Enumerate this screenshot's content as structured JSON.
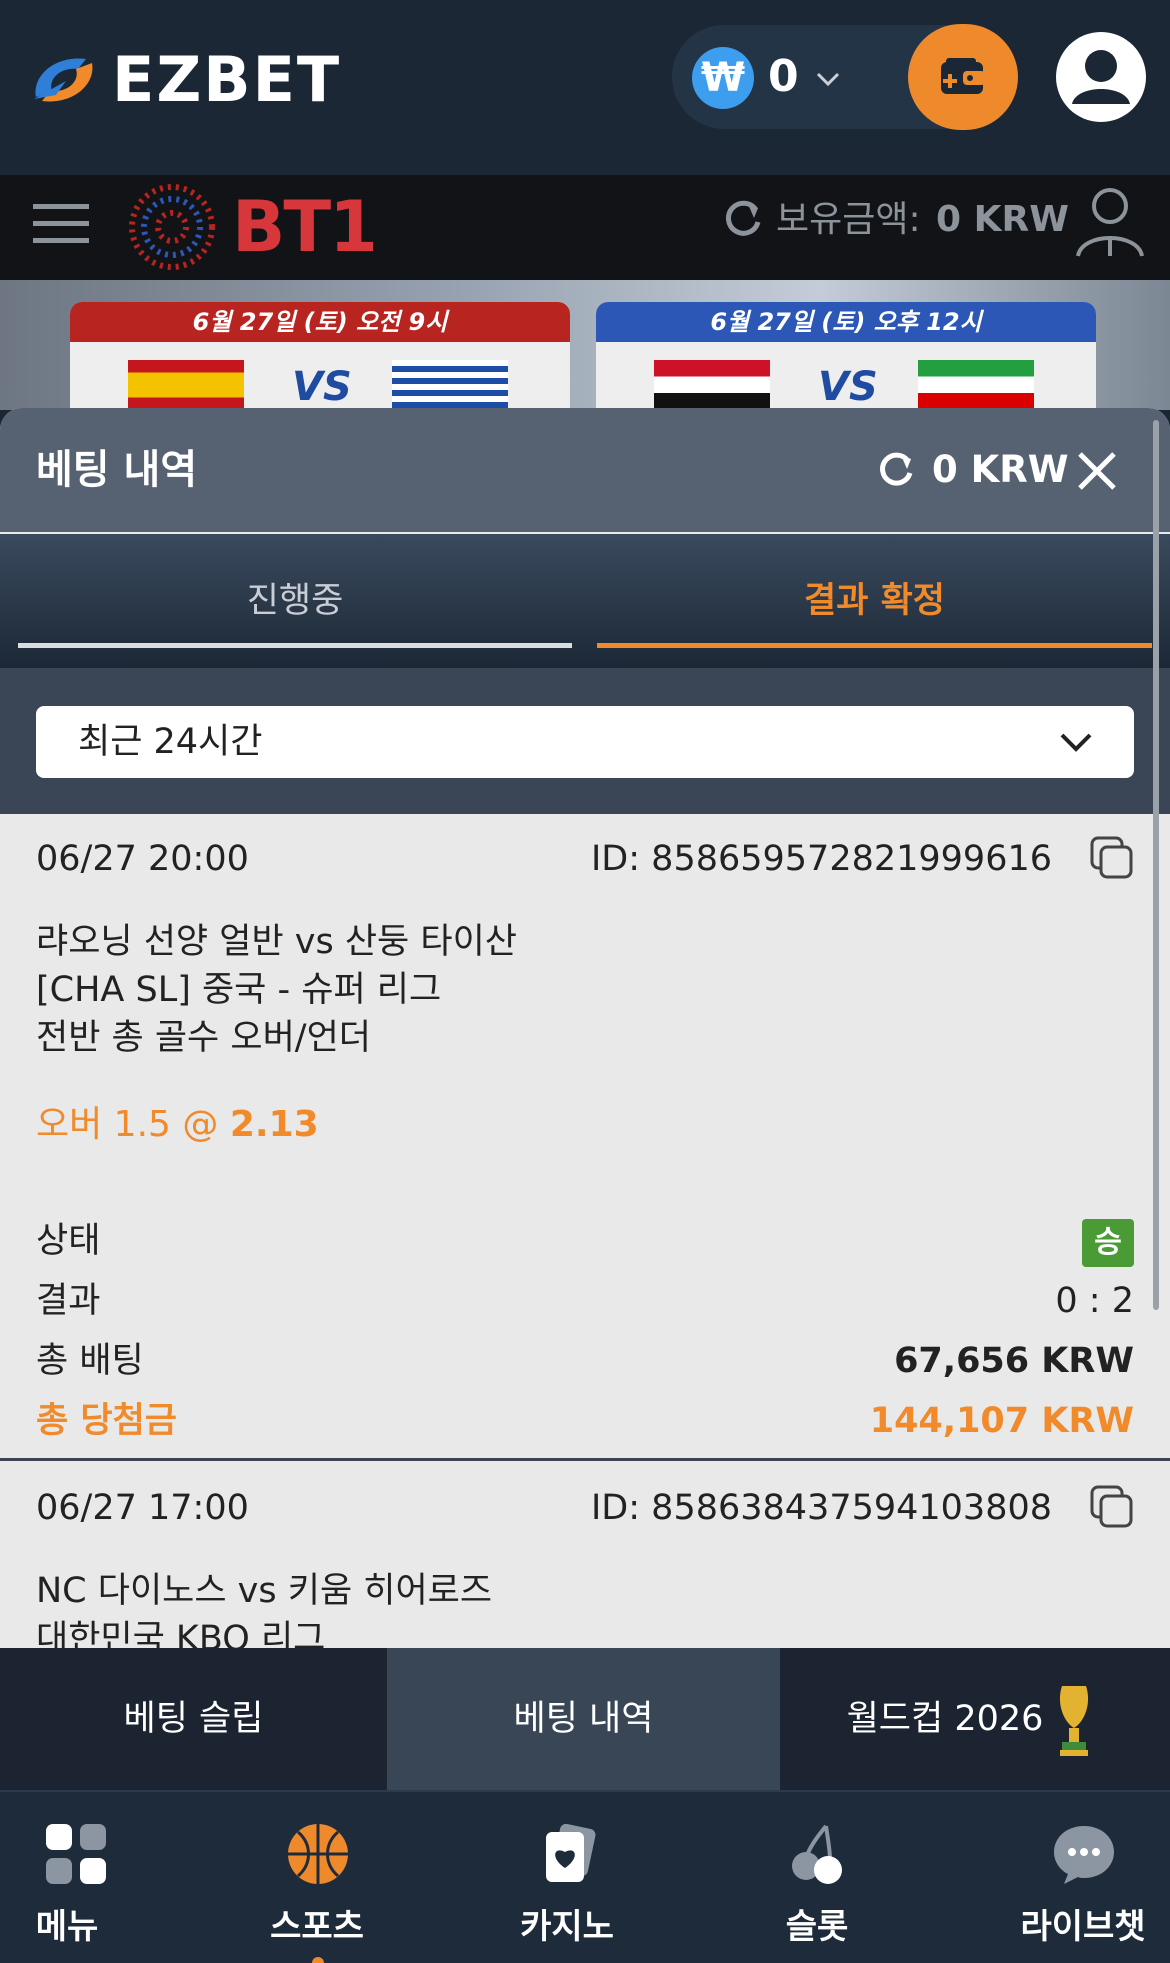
{
  "header": {
    "brand": "EZBET",
    "wallet": {
      "currency_symbol": "₩",
      "amount": "0"
    }
  },
  "subheader": {
    "brand": "BT1",
    "balance_label": "보유금액:",
    "balance_value": "0 KRW"
  },
  "banner": {
    "match1_date": "6월 27일 (토) 오전 9시",
    "match2_date": "6월 27일 (토) 오후 12시",
    "vs": "VS",
    "colors": {
      "match1_head": "#b8241f",
      "match2_head": "#2c57b7"
    }
  },
  "panel": {
    "title": "베팅 내역",
    "amount": "0 KRW",
    "tabs": [
      {
        "label": "진행중",
        "active": false
      },
      {
        "label": "결과 확정",
        "active": true
      }
    ],
    "filter": {
      "selected": "최근 24시간"
    }
  },
  "bets": [
    {
      "time": "06/27 20:00",
      "id": "ID: 858659572821999616",
      "match": "랴오닝 선양 얼반 vs 산둥 타이산",
      "league": "[CHA SL] 중국 - 슈퍼 리그",
      "market": "전반 총 골수 오버/언더",
      "pick": "오버 1.5 @",
      "odds": "2.13",
      "status_label": "상태",
      "status_value": "승",
      "result_label": "결과",
      "result_value": "0 : 2",
      "stake_label": "총 배팅",
      "stake_value": "67,656 KRW",
      "payout_label": "총 당첨금",
      "payout_value": "144,107 KRW"
    },
    {
      "time": "06/27 17:00",
      "id": "ID: 858638437594103808",
      "match": "NC 다이노스 vs 키움 히어로즈",
      "league": "대한민국 KBO 리그"
    }
  ],
  "subbar": {
    "items": [
      {
        "label": "베팅 슬립",
        "active": false
      },
      {
        "label": "베팅 내역",
        "active": true
      },
      {
        "label": "월드컵 2026",
        "active": false
      }
    ]
  },
  "bottomnav": {
    "items": [
      {
        "label": "메뉴",
        "icon": "grid-icon"
      },
      {
        "label": "스포츠",
        "icon": "basketball-icon",
        "active": true
      },
      {
        "label": "카지노",
        "icon": "cards-icon"
      },
      {
        "label": "슬롯",
        "icon": "cherry-icon"
      },
      {
        "label": "라이브챗",
        "icon": "chat-icon"
      }
    ]
  },
  "colors": {
    "accent": "#f08a2a",
    "win": "#4a9a35",
    "wallet_blue": "#3d9ef0"
  }
}
